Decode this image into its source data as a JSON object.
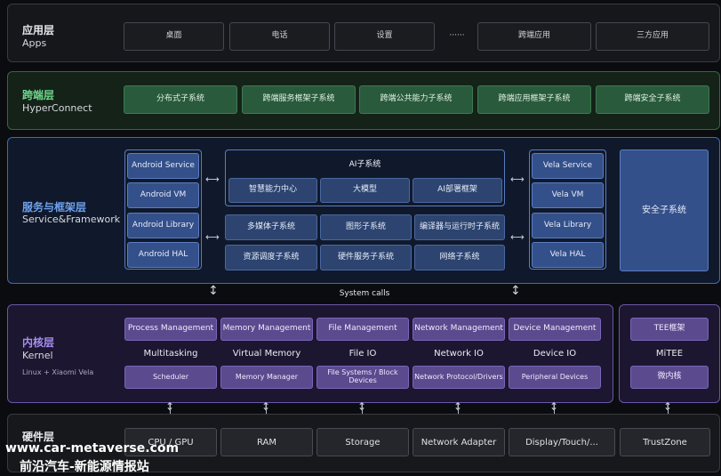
{
  "apps_layer": {
    "title": "应用层",
    "subtitle": "Apps",
    "items": [
      "桌面",
      "电话",
      "设置",
      "······",
      "跨端应用",
      "三方应用"
    ]
  },
  "hyperconnect_layer": {
    "title": "跨端层",
    "subtitle": "HyperConnect",
    "items": [
      "分布式子系统",
      "跨端服务框架子系统",
      "跨端公共能力子系统",
      "跨端应用框架子系统",
      "跨端安全子系统"
    ]
  },
  "service_layer": {
    "title": "服务与框架层",
    "subtitle": "Service&Framework",
    "android": [
      "Android Service",
      "Android VM",
      "Android Library",
      "Android HAL"
    ],
    "ai_title": "AI子系统",
    "ai_items": [
      "智慧能力中心",
      "大模型",
      "AI部署框架"
    ],
    "middle_row1": [
      "多媒体子系统",
      "图形子系统",
      "编译器与运行时子系统"
    ],
    "middle_row2": [
      "资源调度子系统",
      "硬件服务子系统",
      "网络子系统"
    ],
    "vela": [
      "Vela Service",
      "Vela VM",
      "Vela Library",
      "Vela HAL"
    ],
    "security": "安全子系统"
  },
  "system_calls": "System calls",
  "kernel_layer": {
    "title": "内核层",
    "subtitle": "Kernel",
    "note": "Linux + Xiaomi Vela",
    "top_boxes": [
      "Process Management",
      "Memory Management",
      "File Management",
      "Network Management",
      "Device Management"
    ],
    "labels": [
      "Multitasking",
      "Virtual Memory",
      "File IO",
      "Network IO",
      "Device IO"
    ],
    "bottom_boxes": [
      "Scheduler",
      "Memory Manager",
      "File Systems / Block Devices",
      "Network Protocol/Drivers",
      "Peripheral Devices"
    ]
  },
  "tee": {
    "top": "TEE框架",
    "label": "MiTEE",
    "bottom": "微内核"
  },
  "hardware_layer": {
    "title": "硬件层",
    "items": [
      "CPU / GPU",
      "RAM",
      "Storage",
      "Network Adapter",
      "Display/Touch/...",
      "TrustZone"
    ]
  },
  "watermark": {
    "line1": "www.car-metaverse.com",
    "line2": "前沿汽车-新能源情报站"
  }
}
